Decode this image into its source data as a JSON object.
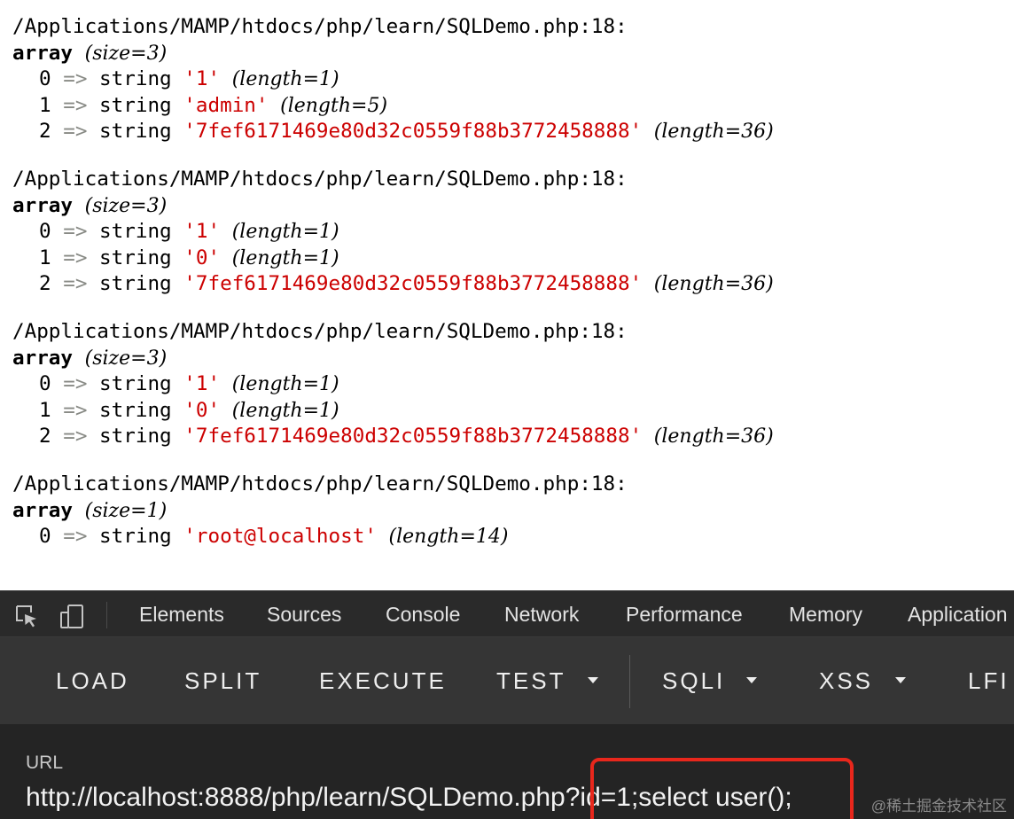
{
  "dumps": [
    {
      "path": "/Applications/MAMP/htdocs/php/learn/SQLDemo.php:18:",
      "keyword": "array",
      "size": "(size=3)",
      "entries": [
        {
          "index": "0",
          "arrow": "=>",
          "type": "string",
          "value": "'1'",
          "length": "(length=1)"
        },
        {
          "index": "1",
          "arrow": "=>",
          "type": "string",
          "value": "'admin'",
          "length": "(length=5)"
        },
        {
          "index": "2",
          "arrow": "=>",
          "type": "string",
          "value": "'7fef6171469e80d32c0559f88b3772458888'",
          "length": "(length=36)"
        }
      ]
    },
    {
      "path": "/Applications/MAMP/htdocs/php/learn/SQLDemo.php:18:",
      "keyword": "array",
      "size": "(size=3)",
      "entries": [
        {
          "index": "0",
          "arrow": "=>",
          "type": "string",
          "value": "'1'",
          "length": "(length=1)"
        },
        {
          "index": "1",
          "arrow": "=>",
          "type": "string",
          "value": "'0'",
          "length": "(length=1)"
        },
        {
          "index": "2",
          "arrow": "=>",
          "type": "string",
          "value": "'7fef6171469e80d32c0559f88b3772458888'",
          "length": "(length=36)"
        }
      ]
    },
    {
      "path": "/Applications/MAMP/htdocs/php/learn/SQLDemo.php:18:",
      "keyword": "array",
      "size": "(size=3)",
      "entries": [
        {
          "index": "0",
          "arrow": "=>",
          "type": "string",
          "value": "'1'",
          "length": "(length=1)"
        },
        {
          "index": "1",
          "arrow": "=>",
          "type": "string",
          "value": "'0'",
          "length": "(length=1)"
        },
        {
          "index": "2",
          "arrow": "=>",
          "type": "string",
          "value": "'7fef6171469e80d32c0559f88b3772458888'",
          "length": "(length=36)"
        }
      ]
    },
    {
      "path": "/Applications/MAMP/htdocs/php/learn/SQLDemo.php:18:",
      "keyword": "array",
      "size": "(size=1)",
      "entries": [
        {
          "index": "0",
          "arrow": "=>",
          "type": "string",
          "value": "'root@localhost'",
          "length": "(length=14)"
        }
      ]
    }
  ],
  "devtools": {
    "icons": [
      "inspect-element-icon",
      "device-toolbar-icon"
    ],
    "tabs": [
      "Elements",
      "Sources",
      "Console",
      "Network",
      "Performance",
      "Memory",
      "Application"
    ]
  },
  "hackbar": {
    "buttons": {
      "load": "LOAD",
      "split": "SPLIT",
      "execute": "EXECUTE",
      "test": "TEST",
      "sqli": "SQLI",
      "xss": "XSS",
      "lfi": "LFI"
    },
    "url_label": "URL",
    "url_value": "http://localhost:8888/php/learn/SQLDemo.php?id=1;select user();"
  },
  "watermark": "@稀土掘金技术社区",
  "colors": {
    "string_value": "#cc0000",
    "arrow": "#888a85",
    "highlight": "#e8271c",
    "devtools_bg": "#242424",
    "toolbar_bg": "#353535"
  }
}
